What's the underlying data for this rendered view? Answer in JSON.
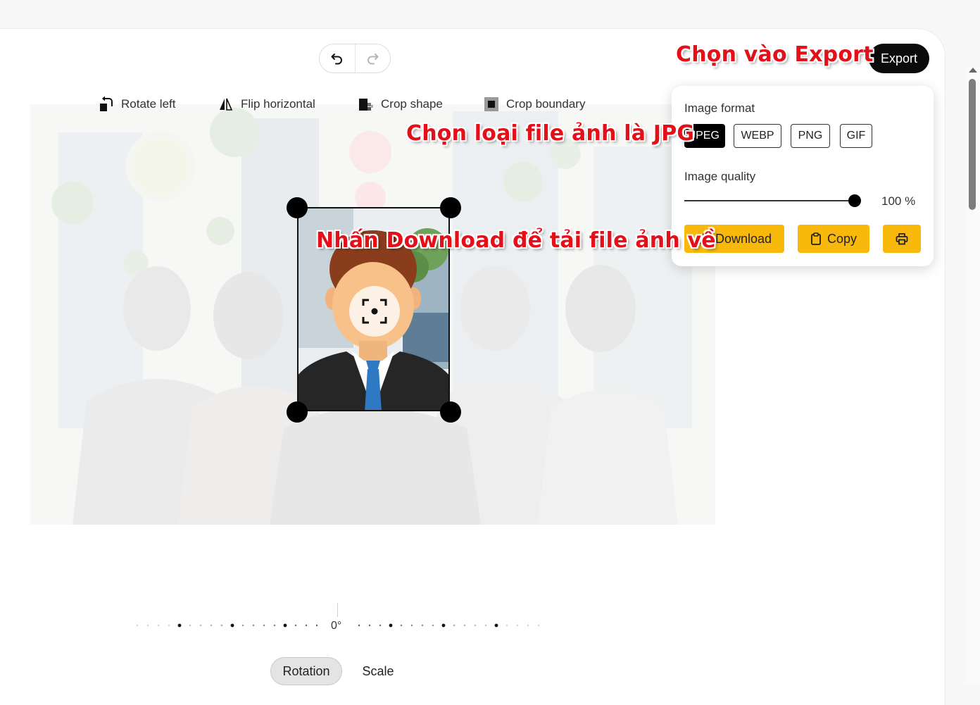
{
  "toolbar": {
    "rotate_left": "Rotate left",
    "flip_horizontal": "Flip horizontal",
    "crop_shape": "Crop shape",
    "crop_boundary": "Crop boundary"
  },
  "export": {
    "button_label": "Export",
    "image_format_label": "Image format",
    "formats": [
      "JPEG",
      "WEBP",
      "PNG",
      "GIF"
    ],
    "selected_format": "JPEG",
    "image_quality_label": "Image quality",
    "quality_value": 100,
    "quality_text": "100 %",
    "download_label": "Download",
    "copy_label": "Copy"
  },
  "annotations": {
    "export": "Chọn vào Export",
    "format": "Chọn loại file ảnh là JPG",
    "download": "Nhấn Download để tải file ảnh về"
  },
  "ruler": {
    "label": "0°"
  },
  "tabs": [
    "Rotation",
    "Scale"
  ],
  "active_tab": "Rotation",
  "colors": {
    "accent": "#f8b90c",
    "annotation": "#e3101a",
    "dark": "#0b0b0b"
  },
  "icons": [
    "undo-icon",
    "redo-icon",
    "rotate-left-icon",
    "flip-horizontal-icon",
    "crop-shape-icon",
    "crop-boundary-icon",
    "focus-icon",
    "download-icon",
    "copy-icon",
    "print-icon"
  ]
}
